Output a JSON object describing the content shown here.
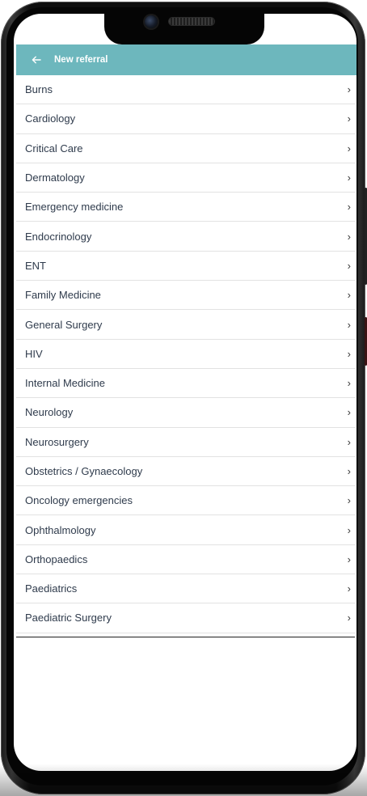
{
  "appbar": {
    "back_icon": "arrow-left-icon",
    "title": "New referral"
  },
  "specialties": [
    {
      "label": "Burns"
    },
    {
      "label": "Cardiology"
    },
    {
      "label": "Critical Care"
    },
    {
      "label": "Dermatology"
    },
    {
      "label": "Emergency medicine"
    },
    {
      "label": "Endocrinology"
    },
    {
      "label": "ENT"
    },
    {
      "label": "Family Medicine"
    },
    {
      "label": "General Surgery"
    },
    {
      "label": "HIV"
    },
    {
      "label": "Internal Medicine"
    },
    {
      "label": "Neurology"
    },
    {
      "label": "Neurosurgery"
    },
    {
      "label": "Obstetrics / Gynaecology"
    },
    {
      "label": "Oncology emergencies"
    },
    {
      "label": "Ophthalmology"
    },
    {
      "label": "Orthopaedics"
    },
    {
      "label": "Paediatrics"
    },
    {
      "label": "Paediatric Surgery"
    }
  ],
  "colors": {
    "appbar": "#6db7bd",
    "row_text": "#2f3b4c",
    "divider": "#e2e2e2"
  }
}
